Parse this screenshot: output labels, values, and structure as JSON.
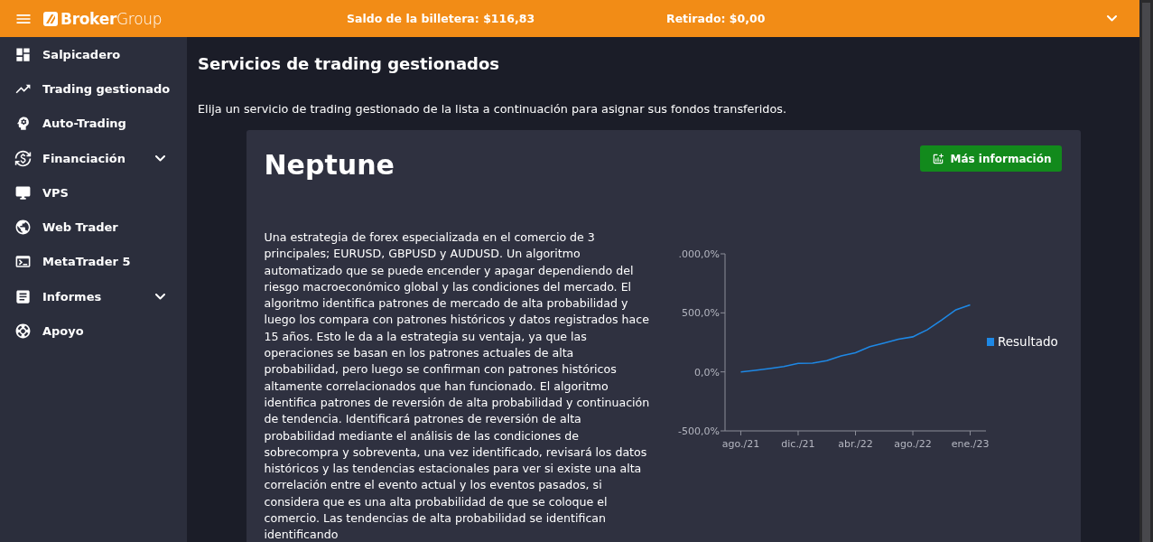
{
  "topbar": {
    "logo": "**Broker**Group",
    "wallet_balance": "Saldo de la billetera: $116,83",
    "withdrawn": "Retirado: $0,00"
  },
  "sidebar": {
    "items": [
      {
        "label": "Salpicadero",
        "has_submenu": false
      },
      {
        "label": "Trading gestionado",
        "has_submenu": false
      },
      {
        "label": "Auto-Trading",
        "has_submenu": false
      },
      {
        "label": "Financiación",
        "has_submenu": true
      },
      {
        "label": "VPS",
        "has_submenu": false
      },
      {
        "label": "Web Trader",
        "has_submenu": false
      },
      {
        "label": "MetaTrader 5",
        "has_submenu": false
      },
      {
        "label": "Informes",
        "has_submenu": true
      },
      {
        "label": "Apoyo",
        "has_submenu": false
      }
    ]
  },
  "page": {
    "title": "Servicios de trading gestionados",
    "intro": "Elija un servicio de trading gestionado de la lista a continuación para asignar sus fondos transferidos."
  },
  "service_card": {
    "name": "Neptune",
    "more_info_button": "Más información",
    "description": "Una estrategia de forex especializada en el comercio de 3 principales; EURUSD, GBPUSD y AUDUSD. Un algoritmo automatizado que se puede encender y apagar dependiendo del riesgo macroeconómico global y las condiciones del mercado. El algoritmo identifica patrones de mercado de alta probabilidad y luego los compara con patrones históricos y datos registrados hace 15 años. Esto le da a la estrategia su ventaja, ya que las operaciones se basan en los patrones actuales de alta probabilidad, pero luego se confirman con patrones históricos altamente correlacionados que han funcionado. El algoritmo identifica patrones de reversión de alta probabilidad y continuación de tendencia. Identificará patrones de reversión de alta probabilidad mediante el análisis de las condiciones de sobrecompra y sobreventa, una vez identificado, revisará los datos históricos y las tendencias estacionales para ver si existe una alta correlación entre el evento actual y los eventos pasados, si considera que es una alta probabilidad de que se coloque el comercio. Las tendencias de alta probabilidad se identifican identificando",
    "chart_data": {
      "type": "line",
      "categories": [
        "ago./21",
        null,
        null,
        null,
        "dic./21",
        null,
        null,
        null,
        "abr./22",
        null,
        null,
        null,
        "ago./22",
        null,
        null,
        null,
        "ene./23"
      ],
      "series": [
        {
          "name": "Resultado",
          "color": "#1e88e5",
          "values": [
            0,
            13,
            28,
            46,
            72,
            74,
            95,
            136,
            162,
            213,
            244,
            277,
            297,
            356,
            438,
            526,
            567
          ]
        }
      ],
      "ylim": [
        -500,
        1000
      ],
      "yticks": [
        {
          "value": -500,
          "label": "-500,0%"
        },
        {
          "value": 0,
          "label": "0,0%"
        },
        {
          "value": 500,
          "label": "500,0%"
        },
        {
          "value": 1000,
          "label": ".000,0%"
        }
      ]
    }
  }
}
